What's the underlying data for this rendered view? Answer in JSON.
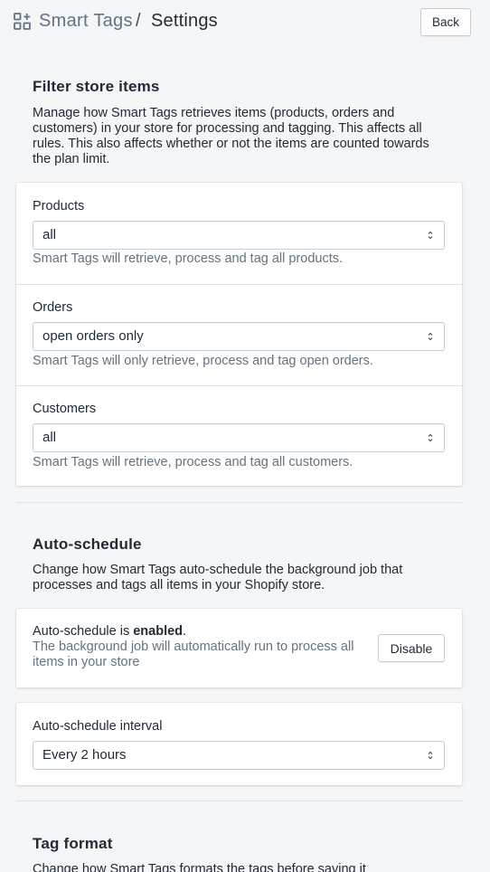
{
  "header": {
    "app_name": "Smart Tags",
    "separator": "/",
    "page_title": "Settings",
    "back_label": "Back"
  },
  "filter_section": {
    "title": "Filter store items",
    "description": "Manage how Smart Tags retrieves items (products, orders and customers) in your store for processing and tagging. This affects all rules. This also affects whether or not the items are counted towards the plan limit.",
    "fields": [
      {
        "label": "Products",
        "value": "all",
        "help": "Smart Tags will retrieve, process and tag all products."
      },
      {
        "label": "Orders",
        "value": "open orders only",
        "help": "Smart Tags will only retrieve, process and tag open orders."
      },
      {
        "label": "Customers",
        "value": "all",
        "help": "Smart Tags will retrieve, process and tag all customers."
      }
    ]
  },
  "auto_schedule_section": {
    "title": "Auto-schedule",
    "description": "Change how Smart Tags auto-schedule the background job that processes and tags all items in your Shopify store.",
    "status_prefix": "Auto-schedule is ",
    "status_value": "enabled",
    "status_suffix": ".",
    "status_desc": "The background job will automatically run to process all items in your store",
    "disable_label": "Disable",
    "interval_label": "Auto-schedule interval",
    "interval_value": "Every 2 hours"
  },
  "tag_format_section": {
    "title": "Tag format",
    "description": "Change how Smart Tags formats the tags before saving it"
  }
}
